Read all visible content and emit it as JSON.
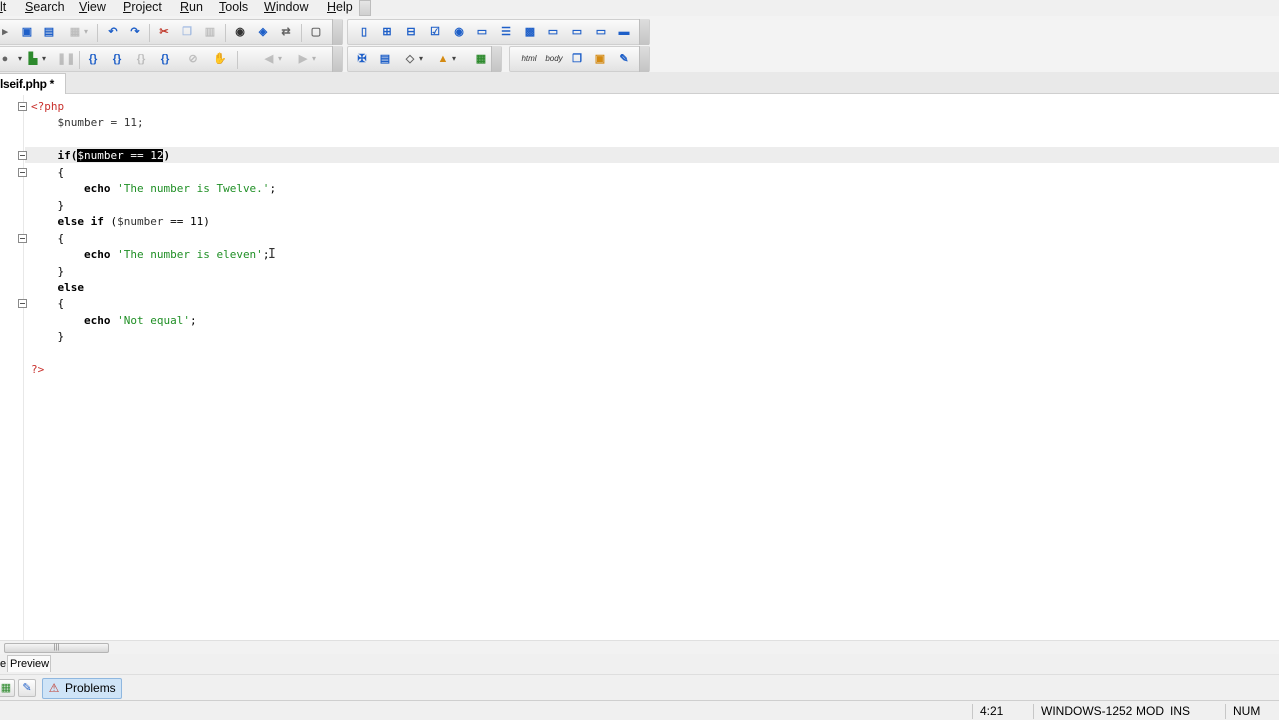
{
  "menu": {
    "items": [
      {
        "label": "lt"
      },
      {
        "label": "Search"
      },
      {
        "label": "View"
      },
      {
        "label": "Project"
      },
      {
        "label": "Run"
      },
      {
        "label": "Tools"
      },
      {
        "label": "Window"
      },
      {
        "label": "Help"
      }
    ]
  },
  "toolbar": {
    "row1": [
      "arrow-dropdown-icon",
      "save-icon",
      "save-all-icon",
      "print-icon",
      "undo-icon",
      "redo-icon",
      "cut-icon",
      "copy-icon",
      "paste-icon",
      "find-icon",
      "find-in-files-icon",
      "replace-icon",
      "toggle-view-icon",
      "html-page-icon",
      "table-icon",
      "grid-icon",
      "checkbox-icon",
      "radio-icon",
      "textfield-icon",
      "list-icon",
      "image-icon",
      "button-icon",
      "input-icon",
      "hidden-field-icon",
      "submit-icon"
    ],
    "row2": [
      "browser-icon",
      "chart-icon",
      "pause-icon",
      "debug-step-into-icon",
      "debug-step-over-icon",
      "debug-step-out-icon",
      "debug-run-to-cursor-icon",
      "stop-icon",
      "hand-icon",
      "back-icon",
      "forward-icon",
      "tools-icon",
      "validate-icon",
      "paint-icon",
      "color-icon",
      "color-table-icon",
      "html-tag-icon",
      "body-tag-icon",
      "copy-page-icon",
      "preview-icon",
      "pencil-icon"
    ],
    "html_tag_label": "html",
    "body_tag_label": "body"
  },
  "editor_tab": {
    "label": "lseif.php *"
  },
  "code": {
    "lines": [
      [
        {
          "t": "<?php",
          "c": "red"
        }
      ],
      [
        {
          "t": "    $number = 11;",
          "c": "var"
        }
      ],
      [
        {
          "t": "",
          "c": ""
        }
      ],
      [
        {
          "t": "    if(",
          "c": "kw"
        },
        {
          "t": "$number == 12",
          "c": "sel"
        },
        {
          "t": ")",
          "c": "kw"
        }
      ],
      [
        {
          "t": "    {",
          "c": ""
        }
      ],
      [
        {
          "t": "        ",
          "c": ""
        },
        {
          "t": "echo",
          "c": "kw"
        },
        {
          "t": " ",
          "c": ""
        },
        {
          "t": "'The number is Twelve.'",
          "c": "green"
        },
        {
          "t": ";",
          "c": ""
        }
      ],
      [
        {
          "t": "    }",
          "c": ""
        }
      ],
      [
        {
          "t": "    else if",
          "c": "kw"
        },
        {
          "t": " (",
          "c": ""
        },
        {
          "t": "$number",
          "c": "var"
        },
        {
          "t": " == 11)",
          "c": ""
        }
      ],
      [
        {
          "t": "    {",
          "c": ""
        }
      ],
      [
        {
          "t": "        ",
          "c": ""
        },
        {
          "t": "echo",
          "c": "kw"
        },
        {
          "t": " ",
          "c": ""
        },
        {
          "t": "'The number is eleven'",
          "c": "green"
        },
        {
          "t": ";",
          "c": ""
        }
      ],
      [
        {
          "t": "    }",
          "c": ""
        }
      ],
      [
        {
          "t": "    else",
          "c": "kw"
        }
      ],
      [
        {
          "t": "    {",
          "c": ""
        }
      ],
      [
        {
          "t": "        ",
          "c": ""
        },
        {
          "t": "echo",
          "c": "kw"
        },
        {
          "t": " ",
          "c": ""
        },
        {
          "t": "'Not equal'",
          "c": "green"
        },
        {
          "t": ";",
          "c": ""
        }
      ],
      [
        {
          "t": "    }",
          "c": ""
        }
      ],
      [
        {
          "t": "",
          "c": ""
        }
      ],
      [
        {
          "t": "?>",
          "c": "red"
        }
      ]
    ],
    "fold_lines": [
      0,
      3,
      4,
      8,
      12
    ]
  },
  "preview": {
    "label": "Preview",
    "edge_label": "e"
  },
  "bottom_panel": {
    "problems_label": "Problems"
  },
  "status": {
    "position": "4:21",
    "encoding": "WINDOWS-1252",
    "modified": "MOD",
    "insert_mode": "INS",
    "numlock": "NUM"
  },
  "colors": {
    "php_tag": "#c9302c",
    "string": "#1f8f25",
    "selection_bg": "#000000",
    "current_line": "#ededed",
    "problems_tab_bg": "#cfe4f7"
  }
}
